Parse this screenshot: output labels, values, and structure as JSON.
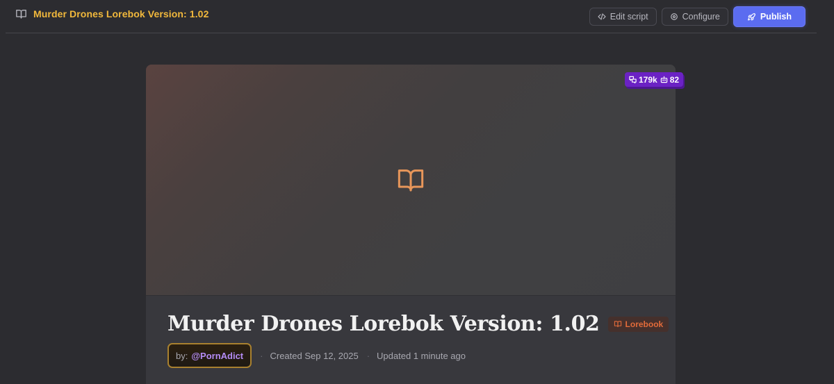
{
  "header": {
    "title": "Murder Drones Lorebok Version: 1.02",
    "buttons": {
      "edit_script": "Edit script",
      "configure": "Configure",
      "publish": "Publish"
    }
  },
  "card": {
    "stats": {
      "chats": "179k",
      "likes": "82"
    },
    "title": "Murder Drones Lorebok Version: 1.02",
    "type_tag": "Lorebook",
    "author_prefix": "by:",
    "author": "@PornAdict",
    "created": "Created Sep 12, 2025",
    "updated": "Updated 1 minute ago",
    "separator": "·"
  },
  "colors": {
    "accent_title": "#f2b93c",
    "publish": "#5b6cf0",
    "badge": "#6b22c4",
    "tag": "#e26b3a",
    "author_link": "#b48cf5",
    "cover_icon": "#e8965a"
  },
  "icons": {
    "title": "book-open-icon",
    "edit_script": "code-icon",
    "configure": "gear-icon",
    "publish": "rocket-icon",
    "chats": "chat-bubbles-icon",
    "likes": "robot-icon",
    "cover": "book-open-icon",
    "tag": "book-open-icon"
  }
}
